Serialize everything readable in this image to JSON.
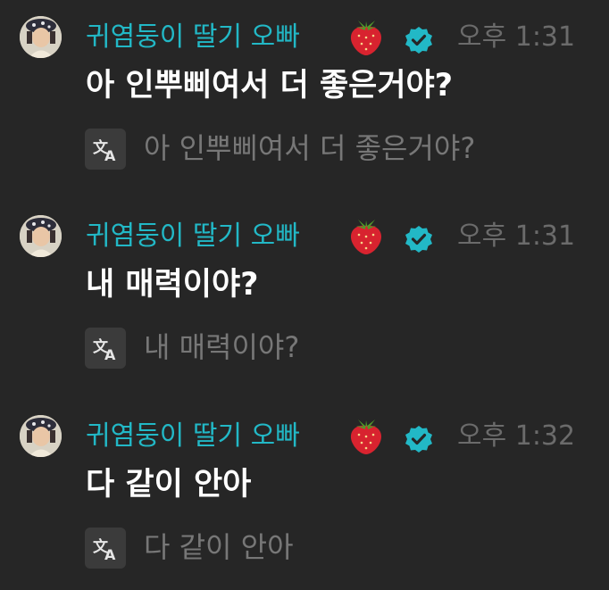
{
  "messages": [
    {
      "username": "귀염둥이 딸기 오빠",
      "username_emoji": "strawberry-emoji",
      "badge": "verified-icon",
      "timestamp": "오후 1:31",
      "text": "아 인뿌삐여서 더 좋은거야?",
      "translation": "아 인뿌삐여서 더 좋은거야?"
    },
    {
      "username": "귀염둥이 딸기 오빠",
      "username_emoji": "strawberry-emoji",
      "badge": "verified-icon",
      "timestamp": "오후 1:31",
      "text": "내 매력이야?",
      "translation": "내 매력이야?"
    },
    {
      "username": "귀염둥이 딸기 오빠",
      "username_emoji": "strawberry-emoji",
      "badge": "verified-icon",
      "timestamp": "오후 1:32",
      "text": "다 같이 안아",
      "translation": "다 같이 안아"
    }
  ],
  "colors": {
    "background": "#262626",
    "username": "#22b8c6",
    "verified_badge": "#22b8c6",
    "timestamp": "#6b6b6b",
    "message_text": "#ffffff",
    "translation_text": "#777777"
  }
}
